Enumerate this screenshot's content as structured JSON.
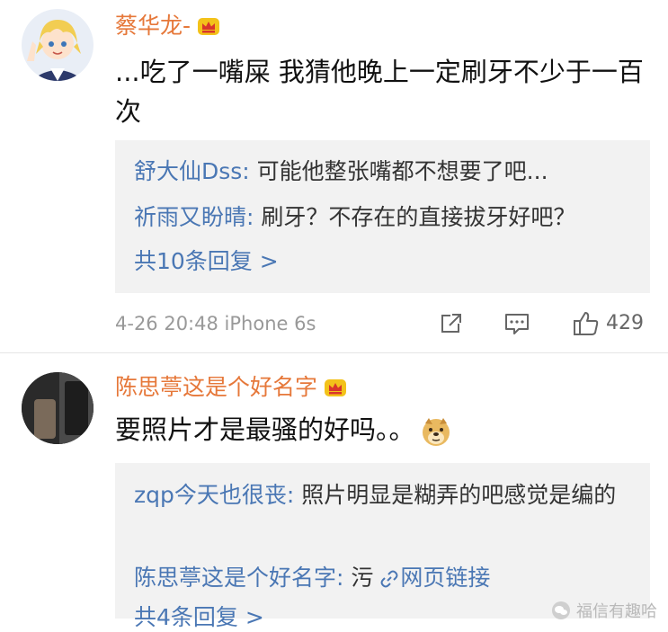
{
  "comments": [
    {
      "username": "蔡华龙-",
      "body": "...吃了一嘴屎 我猜他晚上一定刷牙不少于一百次",
      "replies": [
        {
          "user": "舒大仙Dss:",
          "text": " 可能他整张嘴都不想要了吧..."
        },
        {
          "user": "祈雨又盼晴:",
          "text": " 刷牙？不存在的直接拔牙好吧？"
        }
      ],
      "more_replies": "共10条回复 >",
      "time": "4-26 20:48",
      "device": "iPhone 6s",
      "like_count": "429"
    },
    {
      "username": "陈思葶这是个好名字",
      "body": "要照片才是最骚的好吗。。",
      "replies": [
        {
          "user": "zqp今天也很丧:",
          "text": " 照片明显是糊弄的吧感觉是编的"
        },
        {
          "user": "陈思葶这是个好名字:",
          "text": " 污",
          "link_text": "网页链接"
        }
      ],
      "more_replies": "共4条回复 >"
    }
  ],
  "watermark": "福信有趣哈",
  "icons": {
    "crown": "crown-badge-icon",
    "repost": "repost-icon",
    "comment": "comment-icon",
    "like": "thumbs-up-icon",
    "link": "link-icon",
    "emoji": "doge-emoji-icon"
  },
  "colors": {
    "username": "#e6783a",
    "reply_user": "#4a77b4",
    "reply_bg": "#f2f2f2",
    "meta": "#999999"
  }
}
